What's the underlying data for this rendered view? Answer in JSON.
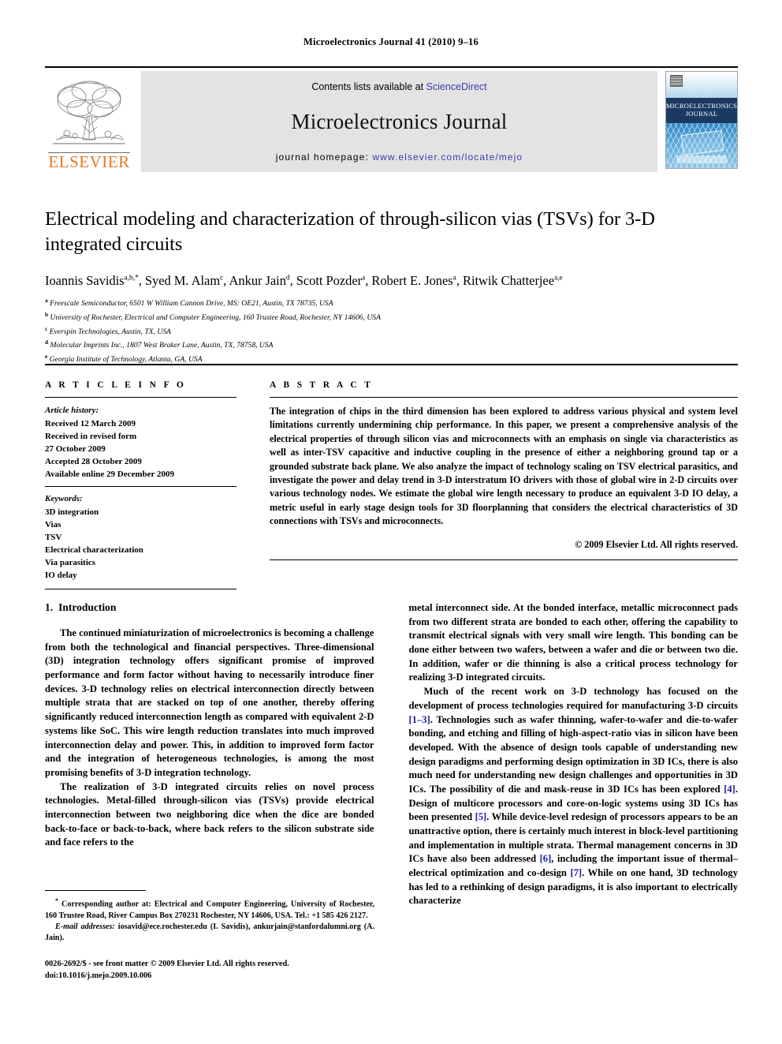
{
  "running_head": "Microelectronics Journal 41 (2010) 9–16",
  "masthead": {
    "publisher_wordmark": "ELSEVIER",
    "contents_prefix": "Contents lists available at ",
    "contents_link": "ScienceDirect",
    "journal_title": "Microelectronics Journal",
    "homepage_prefix": "journal homepage: ",
    "homepage_link": "www.elsevier.com/locate/mejo",
    "cover": {
      "line1": "Microelectronics",
      "line2": "Journal"
    },
    "accent_orange": "#E87722",
    "link_blue": "#3a3ab0",
    "banner_gray": "#e3e3e3"
  },
  "title": "Electrical modeling and characterization of through-silicon vias (TSVs) for 3-D integrated circuits",
  "authors": [
    {
      "name": "Ioannis Savidis",
      "sup": "a,b,*"
    },
    {
      "name": "Syed M. Alam",
      "sup": "c"
    },
    {
      "name": "Ankur Jain",
      "sup": "d"
    },
    {
      "name": "Scott Pozder",
      "sup": "a"
    },
    {
      "name": "Robert E. Jones",
      "sup": "a"
    },
    {
      "name": "Ritwik Chatterjee",
      "sup": "a,e"
    }
  ],
  "affiliations": [
    {
      "mark": "a",
      "text": "Freescale Semiconductor, 6501 W William Cannon Drive, MS: OE21, Austin, TX 78735, USA"
    },
    {
      "mark": "b",
      "text": "University of Rochester, Electrical and Computer Engineering, 160 Trustee Road, Rochester, NY 14606, USA"
    },
    {
      "mark": "c",
      "text": "Everspin Technologies, Austin, TX, USA"
    },
    {
      "mark": "d",
      "text": "Molecular Imprints Inc., 1807 West Braker Lane, Austin, TX, 78758, USA"
    },
    {
      "mark": "e",
      "text": "Georgia Institute of Technology, Atlanta, GA, USA"
    }
  ],
  "article_info": {
    "heading": "A R T I C L E  I N F O",
    "history_label": "Article history:",
    "history": [
      "Received 12 March 2009",
      "Received in revised form",
      "27 October 2009",
      "Accepted 28 October 2009",
      "Available online 29 December 2009"
    ],
    "keywords_label": "Keywords:",
    "keywords": [
      "3D integration",
      "Vias",
      "TSV",
      "Electrical characterization",
      "Via parasitics",
      "IO delay"
    ]
  },
  "abstract": {
    "heading": "A B S T R A C T",
    "text": "The integration of chips in the third dimension has been explored to address various physical and system level limitations currently undermining chip performance. In this paper, we present a comprehensive analysis of the electrical properties of through silicon vias and microconnects with an emphasis on single via characteristics as well as inter-TSV capacitive and inductive coupling in the presence of either a neighboring ground tap or a grounded substrate back plane. We also analyze the impact of technology scaling on TSV electrical parasitics, and investigate the power and delay trend in 3-D interstratum IO drivers with those of global wire in 2-D circuits over various technology nodes. We estimate the global wire length necessary to produce an equivalent 3-D IO delay, a metric useful in early stage design tools for 3D floorplanning that considers the electrical characteristics of 3D connections with TSVs and microconnects.",
    "copyright": "© 2009 Elsevier Ltd. All rights reserved."
  },
  "section": {
    "number": "1.",
    "title": "Introduction"
  },
  "body": {
    "left_p1": "The continued miniaturization of microelectronics is becoming a challenge from both the technological and financial perspectives. Three-dimensional (3D) integration technology offers significant promise of improved performance and form factor without having to necessarily introduce finer devices. 3-D technology relies on electrical interconnection directly between multiple strata that are stacked on top of one another, thereby offering significantly reduced interconnection length as compared with equivalent 2-D systems like SoC. This wire length reduction translates into much improved interconnection delay and power. This, in addition to improved form factor and the integration of heterogeneous technologies, is among the most promising benefits of 3-D integration technology.",
    "left_p2": "The realization of 3-D integrated circuits relies on novel process technologies. Metal-filled through-silicon vias (TSVs) provide electrical interconnection between two neighboring dice when the dice are bonded back-to-face or back-to-back, where back refers to the silicon substrate side and face refers to the",
    "right_p1": "metal interconnect side. At the bonded interface, metallic microconnect pads from two different strata are bonded to each other, offering the capability to transmit electrical signals with very small wire length. This bonding can be done either between two wafers, between a wafer and die or between two die. In addition, wafer or die thinning is also a critical process technology for realizing 3-D integrated circuits.",
    "right_p2_a": "Much of the recent work on 3-D technology has focused on the development of process technologies required for manufacturing 3-D circuits ",
    "right_cit_1": "[1–3]",
    "right_p2_b": ". Technologies such as wafer thinning, wafer-to-wafer and die-to-wafer bonding, and etching and filling of high-aspect-ratio vias in silicon have been developed. With the absence of design tools capable of understanding new design paradigms and performing design optimization in 3D ICs, there is also much need for understanding new design challenges and opportunities in 3D ICs. The possibility of die and mask-reuse in 3D ICs has been explored ",
    "right_cit_2": "[4]",
    "right_p2_c": ". Design of multicore processors and core-on-logic systems using 3D ICs has been presented ",
    "right_cit_3": "[5]",
    "right_p2_d": ". While device-level redesign of processors appears to be an unattractive option, there is certainly much interest in block-level partitioning and implementation in multiple strata. Thermal management concerns in 3D ICs have also been addressed ",
    "right_cit_4": "[6]",
    "right_p2_e": ", including the important issue of thermal–electrical optimization and co-design ",
    "right_cit_5": "[7]",
    "right_p2_f": ". While on one hand, 3D technology has led to a rethinking of design paradigms, it is also important to electrically characterize"
  },
  "footnote": {
    "corresponding": "Corresponding author at: Electrical and Computer Engineering, University of Rochester, 160 Trustee Road, River Campus Box 270231 Rochester, NY 14606, USA. Tel.: +1 585 426 2127.",
    "email_label": "E-mail addresses:",
    "emails": "iosavid@ece.rochester.edu (I. Savidis), ankurjain@stanfordalumni.org (A. Jain).",
    "imprint_line1": "0026-2692/$ - see front matter © 2009 Elsevier Ltd. All rights reserved.",
    "imprint_line2": "doi:10.1016/j.mejo.2009.10.006"
  }
}
